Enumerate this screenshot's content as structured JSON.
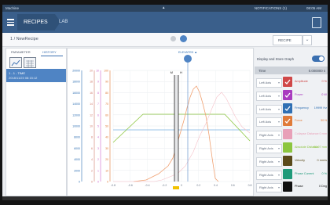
{
  "status": {
    "left": "Machine",
    "right1": "NOTIFICATIONS (1)",
    "right2": "08:05 AM"
  },
  "appbar": {
    "section": "RECIPES",
    "subsection": "LAB"
  },
  "toolbar": {
    "recipe_name": "1 / NewRecipe",
    "recipe_dropdown": "RECIPE"
  },
  "left_panel": {
    "tabs": [
      "PARAMETER",
      "HISTORY"
    ],
    "selected_item": {
      "line1": "1 - 1 - TIME",
      "line2": "2018/11/23 08:15:12"
    }
  },
  "chart": {
    "marker_label": "ELEVATED ▲",
    "cursor_label_left": "M",
    "cursor_label_right": "H",
    "axis_cols": [
      {
        "color": "#2f6fb3",
        "ticks": [
          "20000",
          "18000",
          "16000",
          "14000",
          "12000",
          "10000",
          "8000",
          "6000",
          "4000",
          "2000",
          "0"
        ]
      },
      {
        "color": "#d07a6a",
        "ticks": [
          "20",
          "18",
          "16",
          "14",
          "12",
          "10",
          "8",
          "6",
          "4",
          "2",
          "0"
        ]
      },
      {
        "color": "#cc66cc",
        "ticks": [
          "10",
          "9",
          "8",
          "7",
          "6",
          "5",
          "4",
          "3",
          "2",
          "1",
          "0"
        ]
      },
      {
        "color": "#e07b39",
        "ticks": [
          "100",
          "90",
          "80",
          "70",
          "60",
          "50",
          "40",
          "30",
          "20",
          "10",
          "0"
        ]
      }
    ],
    "x_ticks": [
      "-0.8",
      "-0.6",
      "-0.4",
      "-0.2",
      "0",
      "0.2",
      "0.4",
      "0.6",
      "0.8"
    ]
  },
  "right_panel": {
    "display_store_label": "Display and Store Graph",
    "time_header": "Time",
    "time_value": "0.000000 s",
    "signals": [
      {
        "axis": "Left Axis",
        "name": "Amplitude",
        "value": "0 %",
        "color": "#d04848",
        "checked": true
      },
      {
        "axis": "Left Axis",
        "name": "Power",
        "value": "0 W",
        "color": "#a93bbf",
        "checked": true
      },
      {
        "axis": "Left Axis",
        "name": "Frequency",
        "value": "19999 Hz",
        "color": "#2f6fb3",
        "checked": true
      },
      {
        "axis": "Left Axis",
        "name": "Force",
        "value": "30 N",
        "color": "#e07b39",
        "checked": true
      },
      {
        "axis": "Right Axis",
        "name": "Collapse Distance",
        "value": "0 mm",
        "color": "#e8a0b8",
        "checked": false
      },
      {
        "axis": "Right Axis",
        "name": "Absolute Distance",
        "value": "60.07 mm",
        "color": "#8cc63f",
        "checked": false
      },
      {
        "axis": "Right Axis",
        "name": "Velocity",
        "value": "0 mm/s",
        "color": "#5a4a1a",
        "checked": false
      },
      {
        "axis": "Right Axis",
        "name": "Phase Current",
        "value": "0 %",
        "color": "#1f9a7a",
        "checked": false
      },
      {
        "axis": "Right Axis",
        "name": "Phase",
        "value": "0 Deg",
        "color": "#111111",
        "checked": false
      }
    ]
  }
}
